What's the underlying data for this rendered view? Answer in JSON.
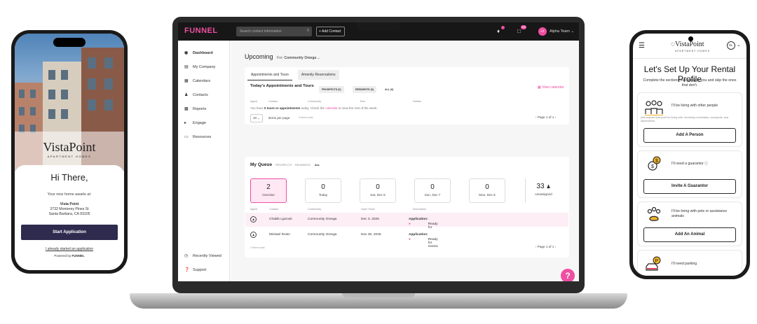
{
  "left_phone": {
    "brand": "VistaPoint",
    "brand_sub": "APARTMENT HOMES",
    "greeting": "Hi There,",
    "intro": "Your new home awaits at:",
    "property_name": "Vista Point",
    "address_line1": "3732 Monterey Pines St",
    "address_line2": "Santa Barbara, CA 93105",
    "start_button": "Start Application",
    "started_link": "I already started an application",
    "powered_by": "Powered by",
    "powered_brand": "FUNNEL"
  },
  "laptop": {
    "topbar": {
      "logo": "FUNNEL",
      "search_placeholder": "Search contact information",
      "add_contact": "Add Contact",
      "team_name": "Alpha Team",
      "avatar_initials": "AT",
      "msg_badge": "999"
    },
    "sidebar": {
      "items": [
        "Dashboard",
        "My Company",
        "Calendars",
        "Contacts",
        "Reports",
        "Engage",
        "Resources"
      ],
      "bottom_items": [
        "Recently Viewed",
        "Support"
      ]
    },
    "upcoming": {
      "title": "Upcoming",
      "for_label": "For:",
      "community": "Community Omega",
      "tabs": [
        "Appointments and Tours",
        "Amenity Reservations"
      ],
      "section_title": "Today's Appointments and Tours",
      "filters": [
        "PROSPECTS (0)",
        "RESIDENTS (0)",
        "ALL (0)"
      ],
      "view_calendar": "View calendar",
      "columns": [
        "Agent",
        "Contact",
        "Community",
        "Time",
        "Details"
      ],
      "empty_text_pre": "You have ",
      "empty_text_bold": "0 tours or appointments",
      "empty_text_mid": " today. Check the ",
      "empty_text_link": "calendar",
      "empty_text_post": " to view the rest of the week.",
      "per_page": "10",
      "per_page_label": "items per page",
      "items_total": "0 items total",
      "pagination": "Page 1 of 1"
    },
    "queue": {
      "title": "My Queue",
      "filters": [
        "PROSPECTS",
        "RESIDENTS",
        "ALL"
      ],
      "stats": [
        {
          "value": "2",
          "label": "Overdue"
        },
        {
          "value": "0",
          "label": "Today"
        },
        {
          "value": "0",
          "label": "Sat, Dec 6"
        },
        {
          "value": "0",
          "label": "Sun, Dec 7"
        },
        {
          "value": "0",
          "label": "Mon, Dec 8"
        },
        {
          "value": "33",
          "label": "Unassigned"
        }
      ],
      "columns": [
        "Agent",
        "Contact",
        "Community",
        "Open Since",
        "Description"
      ],
      "rows": [
        {
          "contact": "Chakib Ljazouli",
          "community": "Community Omega",
          "open_since": "Dec 3, 2025",
          "desc_bold": "Application:",
          "desc": " Ready for review"
        },
        {
          "contact": "Mickael Rosin",
          "community": "Community Omega",
          "open_since": "Nov 30, 2025",
          "desc_bold": "Application:",
          "desc": " Ready for review"
        }
      ],
      "items_total": "2 items total",
      "pagination": "Page 1 of 1"
    },
    "help": "?"
  },
  "right_phone": {
    "brand": "VistaPoint",
    "brand_sub": "APARTMENT HOMES",
    "lang": "EL",
    "title": "Let's Set Up Your Rental Profile",
    "subtitle": "Complete the sections that apply to you and skip the ones that don't.",
    "cards": [
      {
        "label": "I'll be living with other people",
        "hint": "Add anyone that you'll be living with, including roommates, occupants, and dependents.",
        "button": "Add A Person"
      },
      {
        "label": "I'll need a guarantor",
        "hint": "",
        "button": "Invite A Guarantor"
      },
      {
        "label": "I'll be living with pets or assistance animals",
        "hint": "",
        "button": "Add An Animal"
      },
      {
        "label": "I'll need parking",
        "hint": "",
        "button": ""
      }
    ]
  },
  "colors": {
    "accent": "#ee4fa1",
    "dark_button": "#2e2b4f",
    "topbar": "#171717"
  }
}
